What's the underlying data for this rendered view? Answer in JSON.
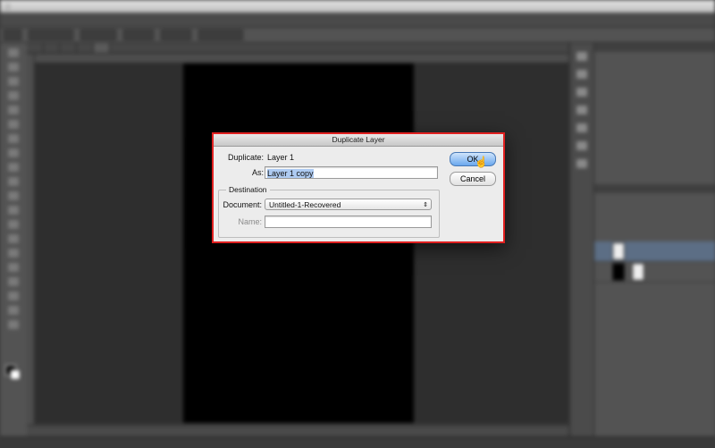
{
  "dialog": {
    "title": "Duplicate Layer",
    "duplicate_label": "Duplicate:",
    "duplicate_value": "Layer 1",
    "as_label": "As:",
    "as_value": "Layer 1 copy",
    "destination_label": "Destination",
    "document_label": "Document:",
    "document_value": "Untitled-1-Recovered",
    "name_label": "Name:",
    "name_value": "",
    "ok_label": "OK",
    "cancel_label": "Cancel"
  },
  "colors": {
    "highlight_border": "#e02020",
    "selected_layer": "#5c6e85"
  },
  "icons": [
    "apple-icon",
    "updown-arrows-icon",
    "pointer-cursor-icon"
  ]
}
